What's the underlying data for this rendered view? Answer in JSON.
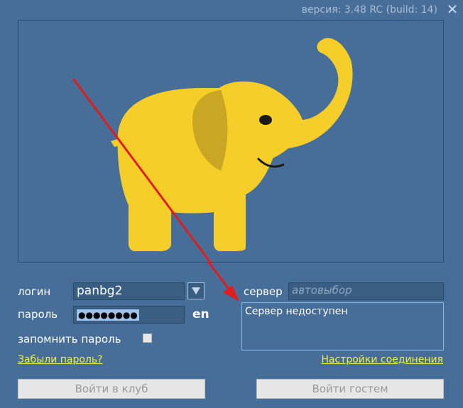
{
  "header": {
    "version_text": "версия: 3.48 RC (build: 14)",
    "close_icon": "close-icon",
    "close_glyph": "✕"
  },
  "logo": {
    "icon": "elephant-logo",
    "color": "#f5ce2a"
  },
  "form": {
    "login_label": "логин",
    "login_value": "panbg2",
    "password_label": "пароль",
    "password_mask": "●●●●●●●●",
    "language": "en",
    "remember_label": "запомнить пароль",
    "remember_checked": false
  },
  "server": {
    "label": "сервер",
    "placeholder": "автовыбор",
    "status": "Сервер недоступен"
  },
  "links": {
    "forgot_password": "Забыли пароль?",
    "connection_settings": "Настройки соединения"
  },
  "buttons": {
    "enter_club": "Войти в клуб",
    "enter_guest": "Войти гостем"
  },
  "colors": {
    "background": "#476e98",
    "elephant": "#f5ce2a",
    "arrow": "#e01c1c",
    "link": "#f0f03c"
  }
}
